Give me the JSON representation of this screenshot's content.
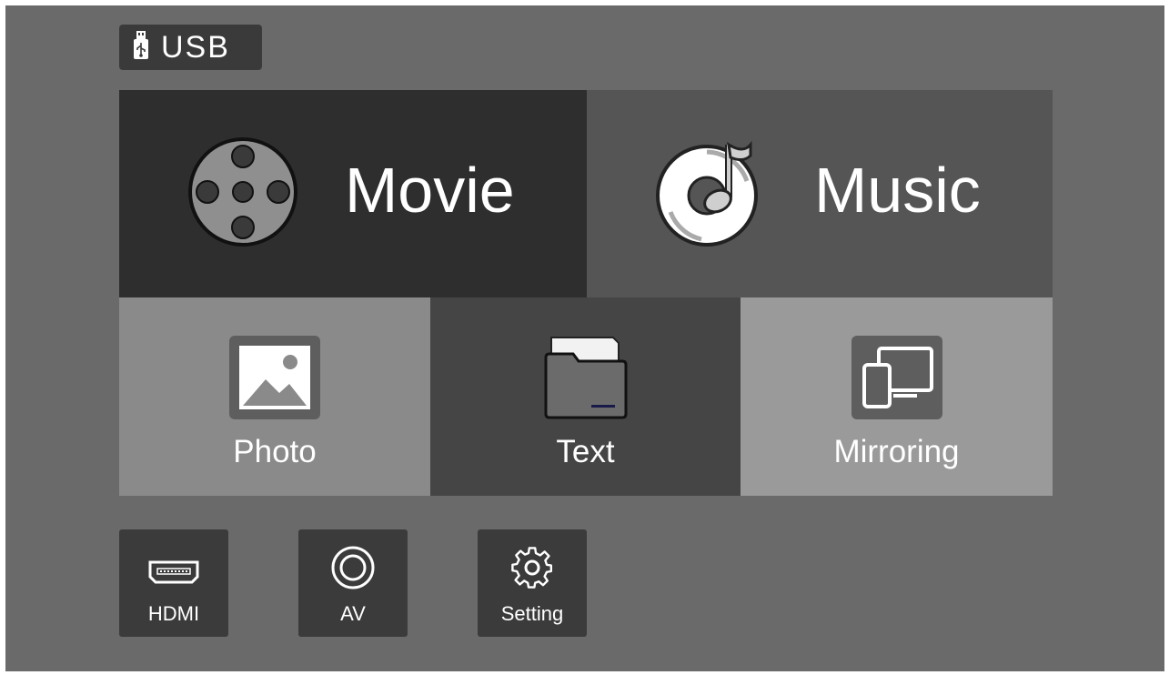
{
  "source": {
    "label": "USB",
    "icon": "usb-drive-icon"
  },
  "tiles": {
    "movie": {
      "label": "Movie",
      "icon": "film-reel-icon"
    },
    "music": {
      "label": "Music",
      "icon": "music-disc-icon"
    },
    "photo": {
      "label": "Photo",
      "icon": "image-icon"
    },
    "text": {
      "label": "Text",
      "icon": "folder-icon"
    },
    "mirroring": {
      "label": "Mirroring",
      "icon": "screen-mirroring-icon"
    }
  },
  "inputs": {
    "hdmi": {
      "label": "HDMI",
      "icon": "hdmi-port-icon"
    },
    "av": {
      "label": "AV",
      "icon": "av-jack-icon"
    },
    "setting": {
      "label": "Setting",
      "icon": "gear-icon"
    }
  },
  "colors": {
    "background": "#6a6a6a",
    "selected_tile": "#2e2e2e"
  }
}
